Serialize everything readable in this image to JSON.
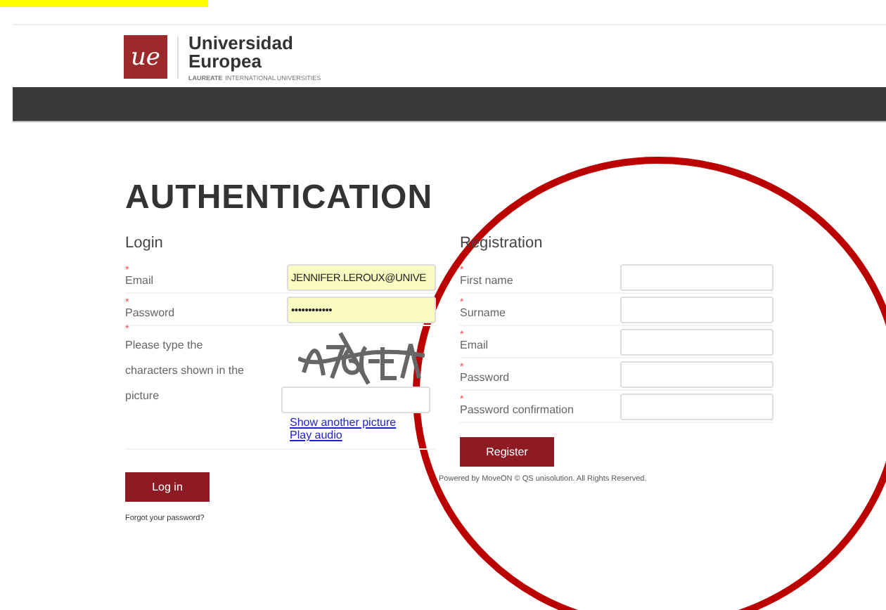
{
  "header": {
    "logo_mark": "ue",
    "logo_title_1": "Universidad",
    "logo_title_2": "Europea",
    "logo_tagline_bold": "LAUREATE",
    "logo_tagline": "INTERNATIONAL UNIVERSITIES"
  },
  "title": "AUTHENTICATION",
  "login": {
    "heading": "Login",
    "fields": [
      {
        "kind": "text",
        "label": "Email",
        "value": "JENNIFER.LEROUX@UNIVE",
        "marker": "*",
        "autofilled": true
      },
      {
        "kind": "password",
        "label": "Password",
        "value": "••••••••••••",
        "marker": "*",
        "autofilled": true
      }
    ],
    "captcha": {
      "label_lines": [
        "Please type the",
        "characters shown in the",
        "picture"
      ],
      "marker": "*",
      "links": [
        "Show another picture",
        "Play audio"
      ]
    },
    "button": "Log in",
    "forgot": "Forgot your password?"
  },
  "registration": {
    "heading": "Registration",
    "fields": [
      {
        "label": "First name",
        "marker": "*"
      },
      {
        "label": "Surname",
        "marker": "*"
      },
      {
        "label": "Email",
        "marker": "*"
      },
      {
        "label": "Password",
        "marker": "*"
      },
      {
        "label": "Password confirmation",
        "marker": "*"
      }
    ],
    "button": "Register"
  },
  "footer": "Powered by MoveON © QS unisolution. All Rights Reserved."
}
